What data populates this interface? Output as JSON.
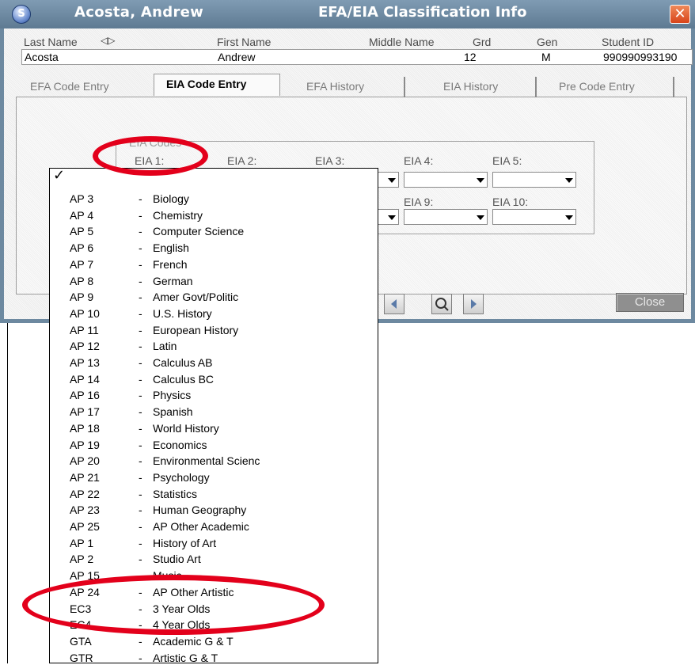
{
  "window": {
    "student_name": "Acosta, Andrew",
    "title": "EFA/EIA Classification Info",
    "close_glyph": "✕"
  },
  "student": {
    "headers": [
      "Last Name",
      "First Name",
      "Middle Name",
      "Grd",
      "Gen",
      "Student ID"
    ],
    "last_name": "Acosta",
    "first_name": "Andrew",
    "middle_name": "",
    "grade": "12",
    "gender": "M",
    "student_id": "990990993190",
    "sort_icon": "◁▷"
  },
  "tabs": [
    "EFA Code Entry",
    "EIA Code Entry",
    "EFA History",
    "EIA History",
    "Pre Code Entry"
  ],
  "active_tab": "EIA Code Entry",
  "eia_codes": {
    "group_label": "EIA Codes",
    "row1_labels": [
      "EIA 1:",
      "EIA 2:",
      "EIA 3:",
      "EIA 4:",
      "EIA 5:"
    ],
    "row2_labels": [
      "EIA 9:",
      "EIA 10:"
    ]
  },
  "footer": {
    "close_label": "Close"
  },
  "dropdown": {
    "checkmark": "✓",
    "separator": "-",
    "items": [
      {
        "code": "AP 3",
        "desc": "Biology"
      },
      {
        "code": "AP 4",
        "desc": "Chemistry"
      },
      {
        "code": "AP 5",
        "desc": "Computer Science"
      },
      {
        "code": "AP 6",
        "desc": "English"
      },
      {
        "code": "AP 7",
        "desc": "French"
      },
      {
        "code": "AP 8",
        "desc": "German"
      },
      {
        "code": "AP 9",
        "desc": "Amer Govt/Politic"
      },
      {
        "code": "AP 10",
        "desc": "U.S. History"
      },
      {
        "code": "AP 11",
        "desc": "European History"
      },
      {
        "code": "AP 12",
        "desc": "Latin"
      },
      {
        "code": "AP 13",
        "desc": "Calculus AB"
      },
      {
        "code": "AP 14",
        "desc": "Calculus BC"
      },
      {
        "code": "AP 16",
        "desc": "Physics"
      },
      {
        "code": "AP 17",
        "desc": "Spanish"
      },
      {
        "code": "AP 18",
        "desc": "World History"
      },
      {
        "code": "AP 19",
        "desc": "Economics"
      },
      {
        "code": "AP 20",
        "desc": "Environmental Scienc"
      },
      {
        "code": "AP 21",
        "desc": "Psychology"
      },
      {
        "code": "AP 22",
        "desc": "Statistics"
      },
      {
        "code": "AP 23",
        "desc": "Human Geography"
      },
      {
        "code": "AP 25",
        "desc": "AP Other Academic"
      },
      {
        "code": "AP 1",
        "desc": "History of Art"
      },
      {
        "code": "AP 2",
        "desc": "Studio Art"
      },
      {
        "code": "AP 15",
        "desc": "Music"
      },
      {
        "code": "AP 24",
        "desc": "AP Other Artistic"
      },
      {
        "code": "EC3",
        "desc": "3 Year Olds"
      },
      {
        "code": "EC4",
        "desc": "4 Year Olds"
      },
      {
        "code": "GTA",
        "desc": "Academic G & T"
      },
      {
        "code": "GTR",
        "desc": "Artistic G & T"
      }
    ]
  },
  "colors": {
    "titlebar": "#6d89a0",
    "annotation": "#e3001b"
  }
}
